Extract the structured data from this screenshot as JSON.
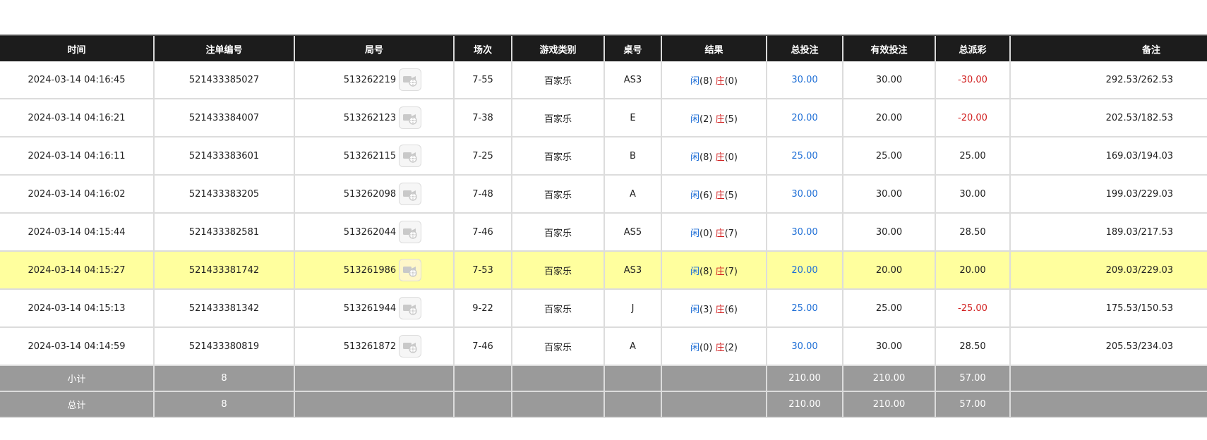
{
  "headers": [
    "时间",
    "注单编号",
    "局号",
    "场次",
    "游戏类别",
    "桌号",
    "结果",
    "总投注",
    "有效投注",
    "总派彩",
    "备注"
  ],
  "labels": {
    "player": "闲",
    "banker": "庄"
  },
  "icons": {
    "video": "video-camera-icon"
  },
  "colors": {
    "header_bg": "#1c1c1c",
    "highlight": "#ffff9e",
    "positive": "#1f6fd6",
    "negative": "#d11f1f",
    "total_bg": "#9a9a9a"
  },
  "rows": [
    {
      "time": "2024-03-14 04:16:45",
      "bet_id": "521433385027",
      "round_id": "513262219",
      "shoe": "7-55",
      "game": "百家乐",
      "table": "AS3",
      "player_score": "(8)",
      "banker_score": "(0)",
      "total_bet": "30.00",
      "valid_bet": "30.00",
      "payout": "-30.00",
      "payout_negative": true,
      "remark": "292.53/262.53",
      "highlight": false
    },
    {
      "time": "2024-03-14 04:16:21",
      "bet_id": "521433384007",
      "round_id": "513262123",
      "shoe": "7-38",
      "game": "百家乐",
      "table": "E",
      "player_score": "(2)",
      "banker_score": "(5)",
      "total_bet": "20.00",
      "valid_bet": "20.00",
      "payout": "-20.00",
      "payout_negative": true,
      "remark": "202.53/182.53",
      "highlight": false
    },
    {
      "time": "2024-03-14 04:16:11",
      "bet_id": "521433383601",
      "round_id": "513262115",
      "shoe": "7-25",
      "game": "百家乐",
      "table": "B",
      "player_score": "(8)",
      "banker_score": "(0)",
      "total_bet": "25.00",
      "valid_bet": "25.00",
      "payout": "25.00",
      "payout_negative": false,
      "remark": "169.03/194.03",
      "highlight": false
    },
    {
      "time": "2024-03-14 04:16:02",
      "bet_id": "521433383205",
      "round_id": "513262098",
      "shoe": "7-48",
      "game": "百家乐",
      "table": "A",
      "player_score": "(6)",
      "banker_score": "(5)",
      "total_bet": "30.00",
      "valid_bet": "30.00",
      "payout": "30.00",
      "payout_negative": false,
      "remark": "199.03/229.03",
      "highlight": false
    },
    {
      "time": "2024-03-14 04:15:44",
      "bet_id": "521433382581",
      "round_id": "513262044",
      "shoe": "7-46",
      "game": "百家乐",
      "table": "AS5",
      "player_score": "(0)",
      "banker_score": "(7)",
      "total_bet": "30.00",
      "valid_bet": "30.00",
      "payout": "28.50",
      "payout_negative": false,
      "remark": "189.03/217.53",
      "highlight": false
    },
    {
      "time": "2024-03-14 04:15:27",
      "bet_id": "521433381742",
      "round_id": "513261986",
      "shoe": "7-53",
      "game": "百家乐",
      "table": "AS3",
      "player_score": "(8)",
      "banker_score": "(7)",
      "total_bet": "20.00",
      "valid_bet": "20.00",
      "payout": "20.00",
      "payout_negative": false,
      "remark": "209.03/229.03",
      "highlight": true
    },
    {
      "time": "2024-03-14 04:15:13",
      "bet_id": "521433381342",
      "round_id": "513261944",
      "shoe": "9-22",
      "game": "百家乐",
      "table": "J",
      "player_score": "(3)",
      "banker_score": "(6)",
      "total_bet": "25.00",
      "valid_bet": "25.00",
      "payout": "-25.00",
      "payout_negative": true,
      "remark": "175.53/150.53",
      "highlight": false
    },
    {
      "time": "2024-03-14 04:14:59",
      "bet_id": "521433380819",
      "round_id": "513261872",
      "shoe": "7-46",
      "game": "百家乐",
      "table": "A",
      "player_score": "(0)",
      "banker_score": "(2)",
      "total_bet": "30.00",
      "valid_bet": "30.00",
      "payout": "28.50",
      "payout_negative": false,
      "remark": "205.53/234.03",
      "highlight": false
    }
  ],
  "subtotal": {
    "label": "小计",
    "count": "8",
    "total_bet": "210.00",
    "valid_bet": "210.00",
    "payout": "57.00"
  },
  "grandtotal": {
    "label": "总计",
    "count": "8",
    "total_bet": "210.00",
    "valid_bet": "210.00",
    "payout": "57.00"
  }
}
